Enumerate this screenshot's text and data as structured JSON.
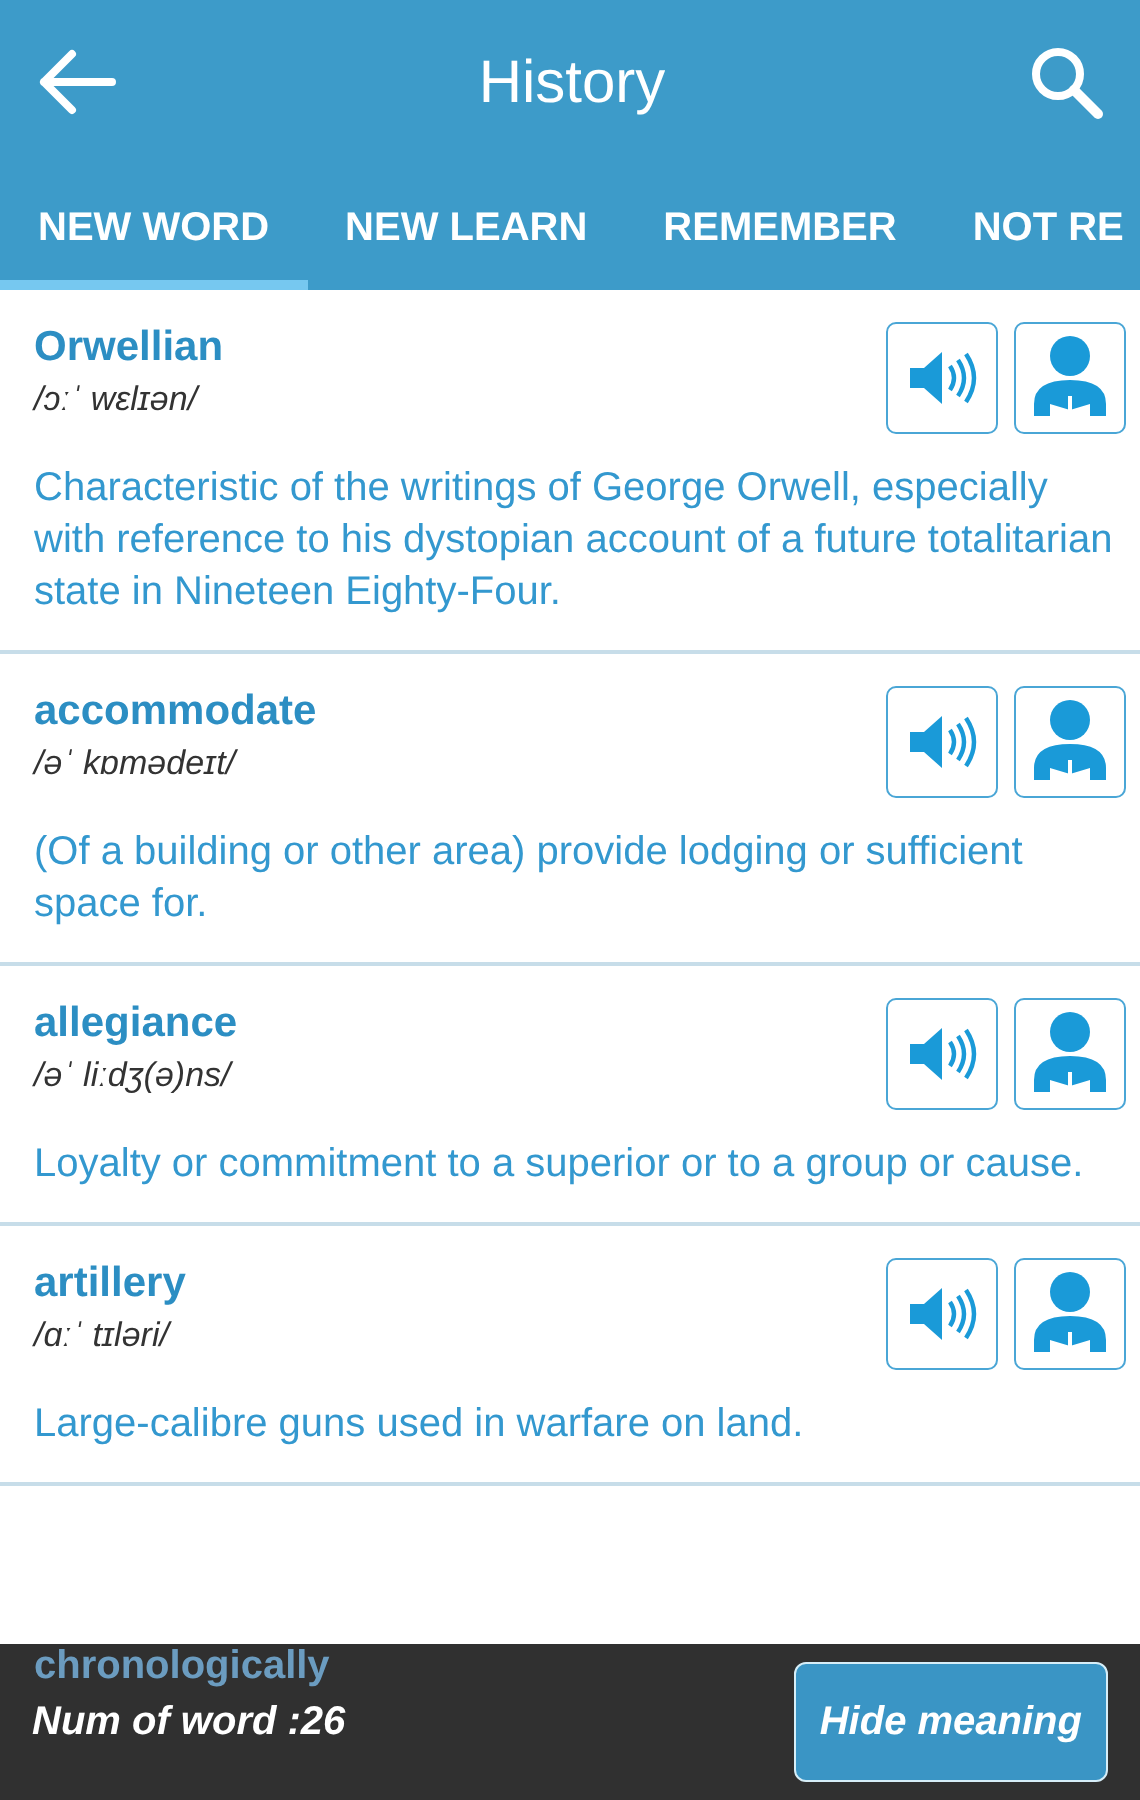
{
  "app_bar": {
    "title": "History"
  },
  "tabs": [
    {
      "label": "NEW WORD",
      "selected": true
    },
    {
      "label": "NEW LEARN",
      "selected": false
    },
    {
      "label": "REMEMBER",
      "selected": false
    },
    {
      "label": "NOT RE",
      "selected": false
    }
  ],
  "entries": [
    {
      "word": "Orwellian",
      "phonetic": "/ɔːˈ wɛlɪən/",
      "meaning": "Characteristic of the writings of George Orwell, especially with reference to his dystopian account of a future totalitarian state in Nineteen Eighty-Four."
    },
    {
      "word": "accommodate",
      "phonetic": "/əˈ kɒmədeɪt/",
      "meaning": "(Of a building or other area) provide lodging or sufficient space for."
    },
    {
      "word": "allegiance",
      "phonetic": "/əˈ liːdʒ(ə)ns/",
      "meaning": "Loyalty or commitment to a superior or to a group or cause."
    },
    {
      "word": "artillery",
      "phonetic": "/ɑːˈ tɪləri/",
      "meaning": "Large-calibre guns used in warfare on land."
    },
    {
      "word": "chronologically"
    }
  ],
  "footer": {
    "count": "Num of word :26",
    "button": "Hide meaning"
  }
}
